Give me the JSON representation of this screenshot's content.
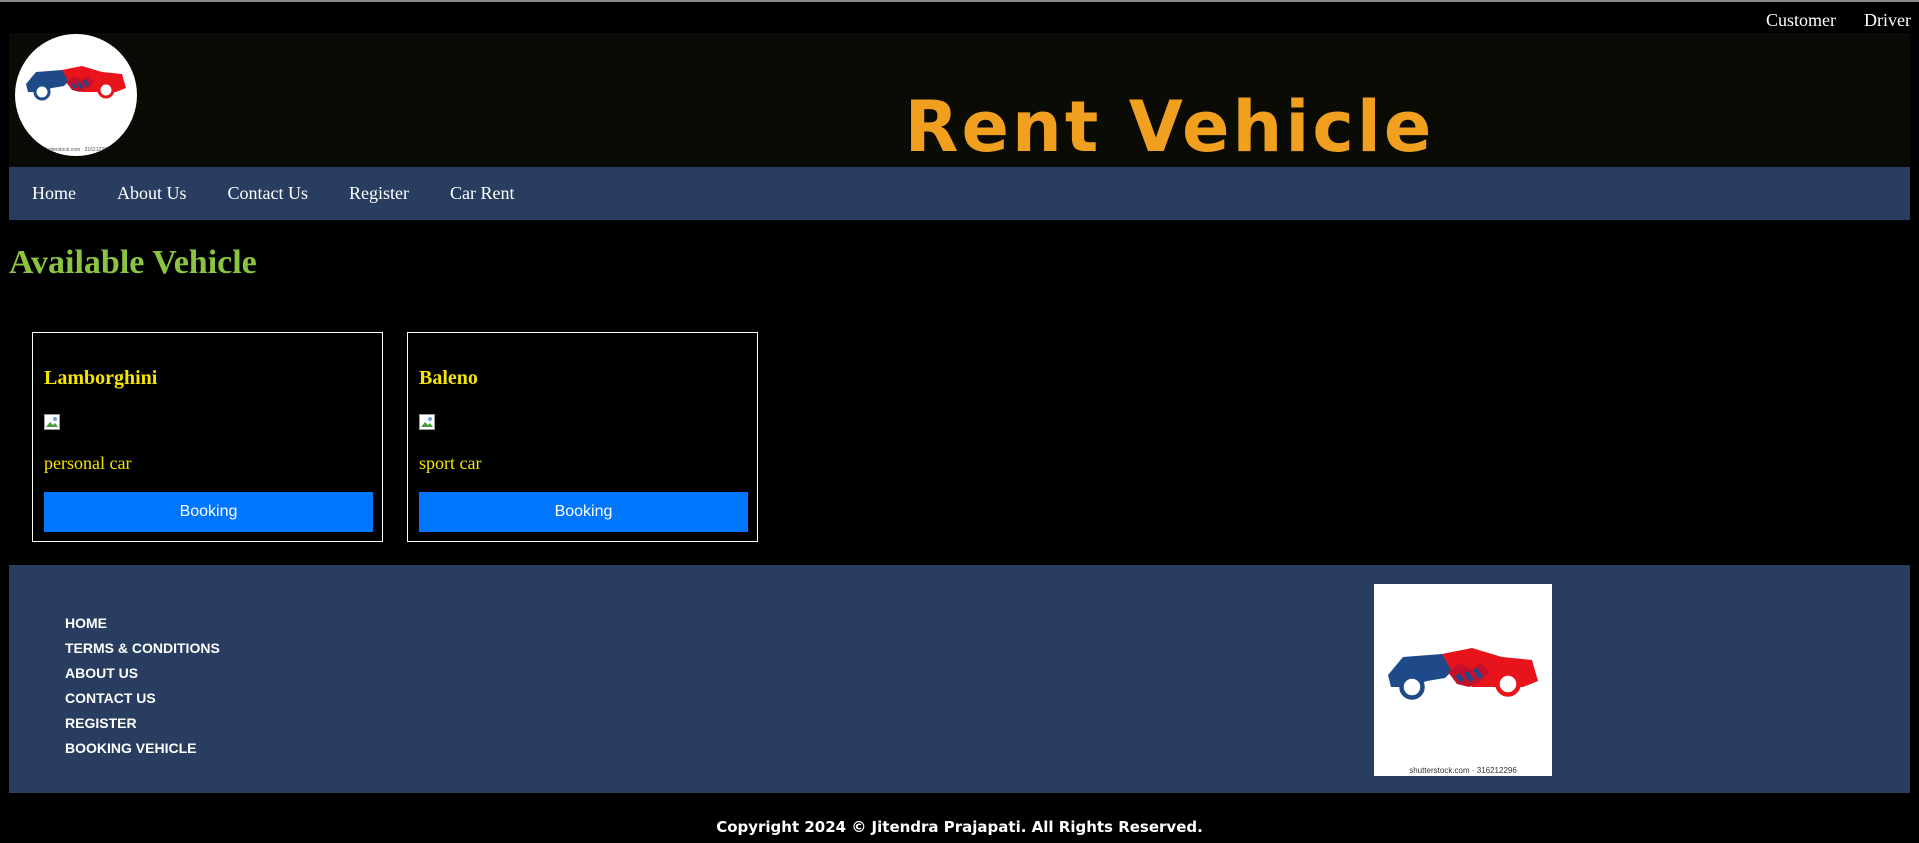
{
  "top_links": [
    "Customer",
    "Driver"
  ],
  "header": {
    "title": "Rent Vehicle",
    "logo_watermark": "shutterstock.com · 316212296"
  },
  "nav": [
    "Home",
    "About Us",
    "Contact Us",
    "Register",
    "Car Rent"
  ],
  "section_title": "Available Vehicle",
  "vehicles": [
    {
      "name": "Lamborghini",
      "type": "personal car",
      "button": "Booking"
    },
    {
      "name": "Baleno",
      "type": "sport car",
      "button": "Booking"
    }
  ],
  "footer": {
    "links": [
      "HOME",
      "TERMS & CONDITIONS",
      "ABOUT US",
      "CONTACT US",
      "REGISTER",
      "BOOKING VEHICLE"
    ],
    "logo_watermark": "shutterstock.com · 316212296"
  },
  "copyright": "Copyright 2024 © Jitendra Prajapati. All Rights Reserved.",
  "colors": {
    "title": "#f0a01e",
    "nav_bg": "#283d5f",
    "section_title": "#8bc53f",
    "card_text": "#f5e500",
    "button": "#0076ff"
  }
}
